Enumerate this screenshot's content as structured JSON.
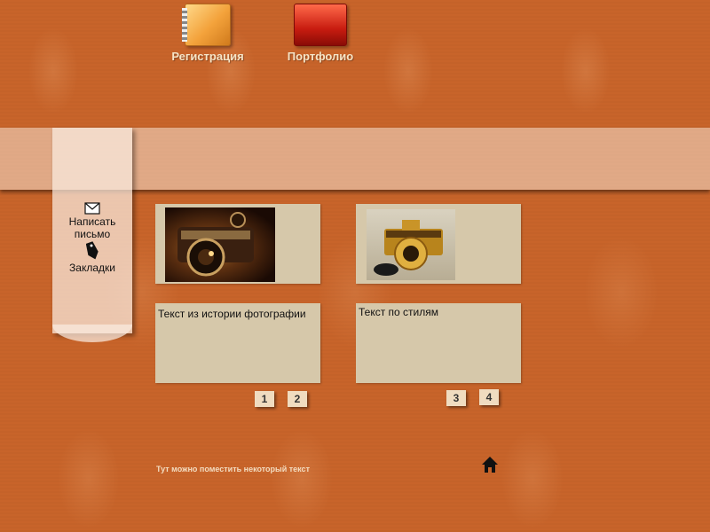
{
  "nav": {
    "items": [
      {
        "label": "Регистрация",
        "icon": "notebook-icon"
      },
      {
        "label": "Портфолио",
        "icon": "folder-icon"
      }
    ]
  },
  "sidebar": {
    "items": [
      {
        "label": "Написать письмо",
        "icon": "envelope-icon"
      },
      {
        "label": "Закладки",
        "icon": "tag-icon"
      }
    ]
  },
  "cards": [
    {
      "image": "vintage-camera-photo",
      "text": "Текст из истории фотографии"
    },
    {
      "image": "gold-camera-photo",
      "text": "Текст по стилям"
    }
  ],
  "pagination": [
    "1",
    "2",
    "3",
    "4"
  ],
  "footer": {
    "text": "Тут можно поместить некоторый текст",
    "home_icon": "home-icon"
  },
  "colors": {
    "background": "#c8642a",
    "card": "#d6c8aa",
    "nav_text": "#f6e4c6"
  }
}
